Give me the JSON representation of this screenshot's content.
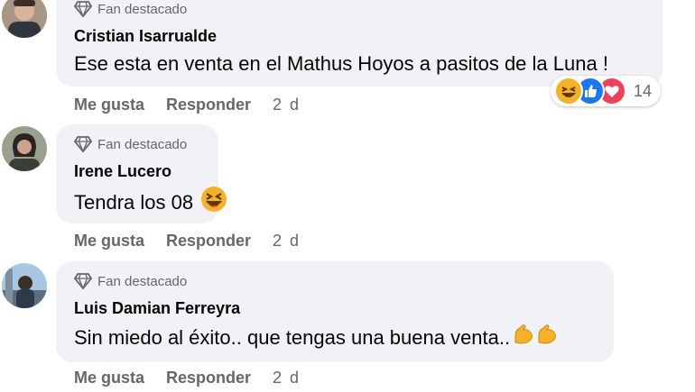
{
  "comments": [
    {
      "badge": "Fan destacado",
      "author": "Cristian Isarrualde",
      "text": "Ese esta en venta en el Mathus Hoyos a pasitos de la Luna !",
      "actions": {
        "like": "Me gusta",
        "reply": "Responder",
        "time": "2 d"
      },
      "reactions": {
        "icons": [
          "haha-icon",
          "like-icon",
          "love-icon"
        ],
        "count": "14"
      },
      "avatar_color": "#7d6a5a"
    },
    {
      "badge": "Fan destacado",
      "author": "Irene Lucero",
      "text": "Tendra los 08",
      "emoji": "laughing-emoji",
      "actions": {
        "like": "Me gusta",
        "reply": "Responder",
        "time": "2 d"
      },
      "avatar_color": "#3d4a3a"
    },
    {
      "badge": "Fan destacado",
      "author": "Luis Damian Ferreyra",
      "text": "Sin miedo al éxito.. que tengas una buena venta..",
      "emoji": "flexed-biceps-emoji",
      "actions": {
        "like": "Me gusta",
        "reply": "Responder",
        "time": "2 d"
      },
      "avatar_color": "#5a7fa0"
    }
  ],
  "colors": {
    "bubble": "#f0f2f5",
    "secondary_text": "#65676b",
    "like_blue": "#1877f2",
    "love_red": "#f33e58",
    "haha_yellow": "#f7b125"
  }
}
